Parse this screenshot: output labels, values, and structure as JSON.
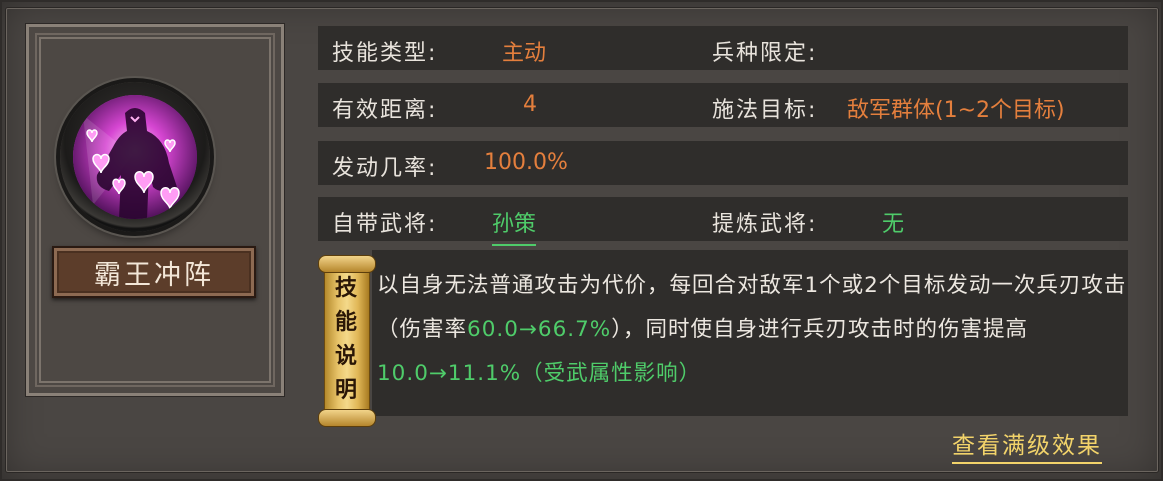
{
  "skill": {
    "name": "霸王冲阵",
    "icon": "purple-hearts-general-icon"
  },
  "rows": {
    "type_label": "技能类型:",
    "type_value": "主动",
    "troop_label": "兵种限定:",
    "troop_value": "",
    "range_label": "有效距离:",
    "range_value": "4",
    "target_label": "施法目标:",
    "target_value": "敌军群体(1~2个目标)",
    "rate_label": "发动几率:",
    "rate_value": "100.0%",
    "own_general_label": "自带武将:",
    "own_general_value": "孙策",
    "refine_general_label": "提炼武将:",
    "refine_general_value": "无"
  },
  "description": {
    "scroll_label": [
      "技",
      "能",
      "说",
      "明"
    ],
    "part1": "以自身无法普通攻击为代价，每回合对敌军1个或2个目标发动一次兵刃攻击（伤害率",
    "hl1": "60.0→66.7%",
    "part2": "），同时使自身进行兵刃攻击时的伤害提高",
    "hl2": "10.0→11.1%（受武属性影响）"
  },
  "actions": {
    "view_max_level": "查看满级效果"
  },
  "colors": {
    "orange": "#e47f3d",
    "green": "#4fcc6a",
    "gold": "#f2d36a"
  }
}
